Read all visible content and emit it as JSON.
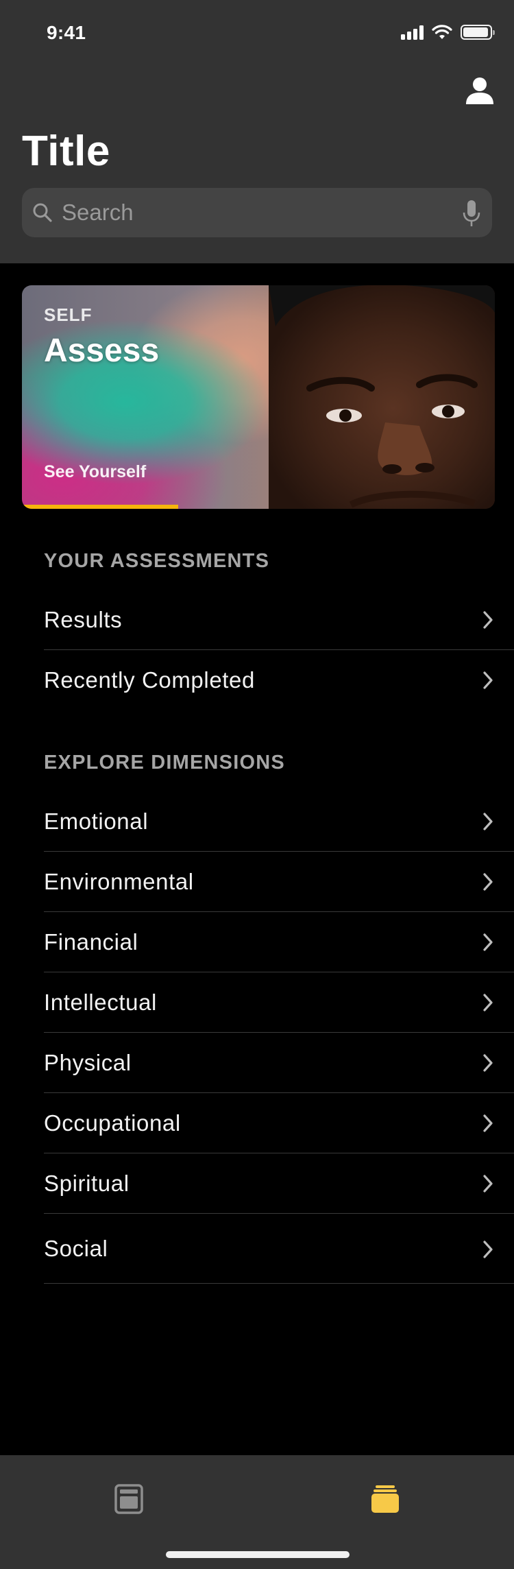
{
  "status_bar": {
    "time": "9:41"
  },
  "header": {
    "title": "Title",
    "search_placeholder": "Search"
  },
  "hero": {
    "eyebrow": "SELF",
    "title": "Assess",
    "link": "See Yourself",
    "progress": 0.33,
    "accent_color": "#f5b50c"
  },
  "your_assessments": {
    "heading": "YOUR ASSESSMENTS",
    "items": [
      {
        "label": "Results"
      },
      {
        "label": "Recently Completed"
      }
    ]
  },
  "explore_dimensions": {
    "heading": "EXPLORE DIMENSIONS",
    "items": [
      {
        "label": "Emotional"
      },
      {
        "label": "Environmental"
      },
      {
        "label": "Financial"
      },
      {
        "label": "Intellectual"
      },
      {
        "label": "Physical"
      },
      {
        "label": "Occupational"
      },
      {
        "label": "Spiritual"
      },
      {
        "label": "Social"
      }
    ]
  },
  "tabbar": {
    "tabs": [
      {
        "icon": "browser-window-icon",
        "selected": false
      },
      {
        "icon": "stack-icon",
        "selected": true,
        "color": "#f7c948"
      }
    ]
  }
}
